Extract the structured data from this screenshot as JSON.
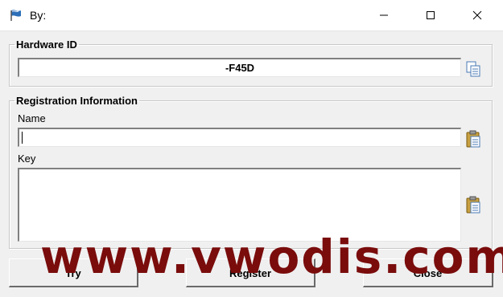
{
  "window": {
    "title": "By:",
    "icons": {
      "app": "flag-icon",
      "minimize": "minimize-icon",
      "maximize": "maximize-icon",
      "close": "close-icon"
    }
  },
  "hardware_group": {
    "legend": "Hardware ID",
    "value": "-F45D",
    "copy_icon": "copy-icon"
  },
  "registration_group": {
    "legend": "Registration Information",
    "name_label": "Name",
    "name_value": "",
    "key_label": "Key",
    "key_value": "",
    "paste_icon": "clipboard-icon"
  },
  "buttons": {
    "try": "Try",
    "register": "Register",
    "close": "Close"
  },
  "watermark": "www.vwodis.com",
  "colors": {
    "window_bg": "#f0f0f0",
    "titlebar_bg": "#ffffff",
    "watermark": "#7a0c0c"
  }
}
